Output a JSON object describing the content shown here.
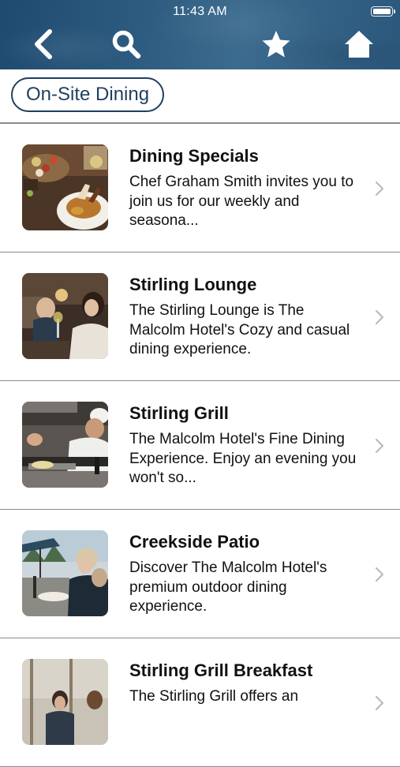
{
  "status_bar": {
    "time": "11:43 AM"
  },
  "nav": {
    "back": "chevron-left-icon",
    "search": "search-icon",
    "favorites": "star-icon",
    "home": "home-icon"
  },
  "filter": {
    "chip_label": "On-Site Dining"
  },
  "colors": {
    "header_blue": "#2d5b80",
    "chip_border": "#1f3f5e",
    "divider": "#8a8a8a",
    "chevron": "#b8b8b8"
  },
  "items": [
    {
      "title": "Dining Specials",
      "description": "Chef Graham Smith invites you to join us for our weekly and seasona..."
    },
    {
      "title": "Stirling Lounge",
      "description": "The Stirling Lounge is The Malcolm Hotel's Cozy and casual dining experience."
    },
    {
      "title": "Stirling Grill",
      "description": "The Malcolm Hotel's Fine Dining Experience. Enjoy an evening you won't so..."
    },
    {
      "title": "Creekside Patio",
      "description": "Discover The Malcolm Hotel's premium outdoor dining experience."
    },
    {
      "title": "Stirling Grill Breakfast",
      "description": "The Stirling Grill offers an"
    }
  ]
}
